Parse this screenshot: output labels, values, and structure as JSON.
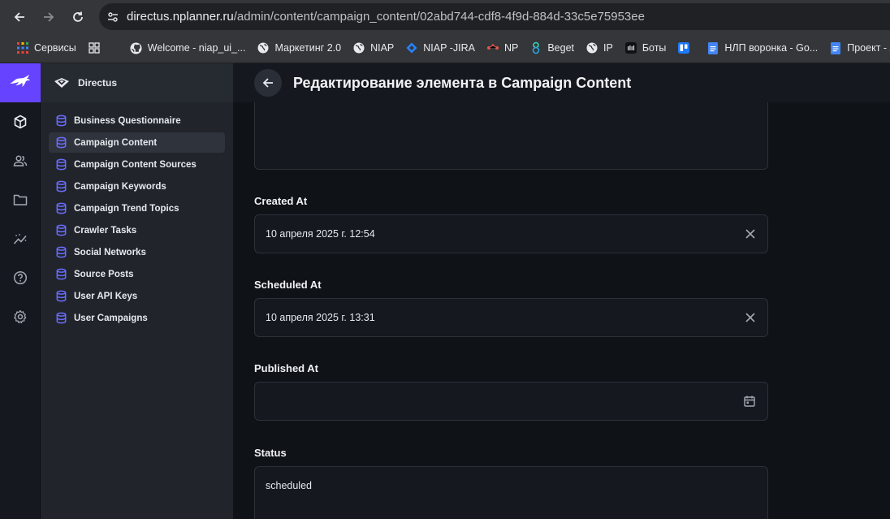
{
  "browser": {
    "url_host": "directus.nplanner.ru",
    "url_path": "/admin/content/campaign_content/02abd744-cdf8-4f9d-884d-33c5e75953ee",
    "bookmarks": [
      {
        "label": "Сервисы",
        "icon": "apps-grid-icon"
      },
      {
        "label": "",
        "icon": "tab-groups-icon"
      },
      {
        "label": "Welcome - niap_ui_...",
        "icon": "github-icon"
      },
      {
        "label": "Маркетинг 2.0",
        "icon": "globe-icon"
      },
      {
        "label": "NIAP",
        "icon": "globe-icon"
      },
      {
        "label": "NIAP -JIRA",
        "icon": "jira-icon"
      },
      {
        "label": "NP",
        "icon": "np-icon"
      },
      {
        "label": "Beget",
        "icon": "beget-icon"
      },
      {
        "label": "IP",
        "icon": "globe-icon"
      },
      {
        "label": "Боты",
        "icon": "bots-icon"
      },
      {
        "label": "",
        "icon": "trello-icon"
      },
      {
        "label": "НЛП воронка - Go...",
        "icon": "google-docs-icon"
      },
      {
        "label": "Проект - AP",
        "icon": "google-docs-icon"
      }
    ]
  },
  "sidebar": {
    "project_name": "Directus",
    "items": [
      {
        "label": "Business Questionnaire",
        "active": false
      },
      {
        "label": "Campaign Content",
        "active": true
      },
      {
        "label": "Campaign Content Sources",
        "active": false
      },
      {
        "label": "Campaign Keywords",
        "active": false
      },
      {
        "label": "Campaign Trend Topics",
        "active": false
      },
      {
        "label": "Crawler Tasks",
        "active": false
      },
      {
        "label": "Social Networks",
        "active": false
      },
      {
        "label": "Source Posts",
        "active": false
      },
      {
        "label": "User API Keys",
        "active": false
      },
      {
        "label": "User Campaigns",
        "active": false
      }
    ]
  },
  "header": {
    "title": "Редактирование элемента в Campaign Content"
  },
  "fields": {
    "created_at": {
      "label": "Created At",
      "value": "10 апреля 2025 г. 12:54"
    },
    "scheduled_at": {
      "label": "Scheduled At",
      "value": "10 апреля 2025 г. 13:31"
    },
    "published_at": {
      "label": "Published At",
      "value": ""
    },
    "status": {
      "label": "Status",
      "value": "scheduled"
    }
  },
  "colors": {
    "accent": "#6644ff",
    "db_icon": "#6a6cff"
  }
}
